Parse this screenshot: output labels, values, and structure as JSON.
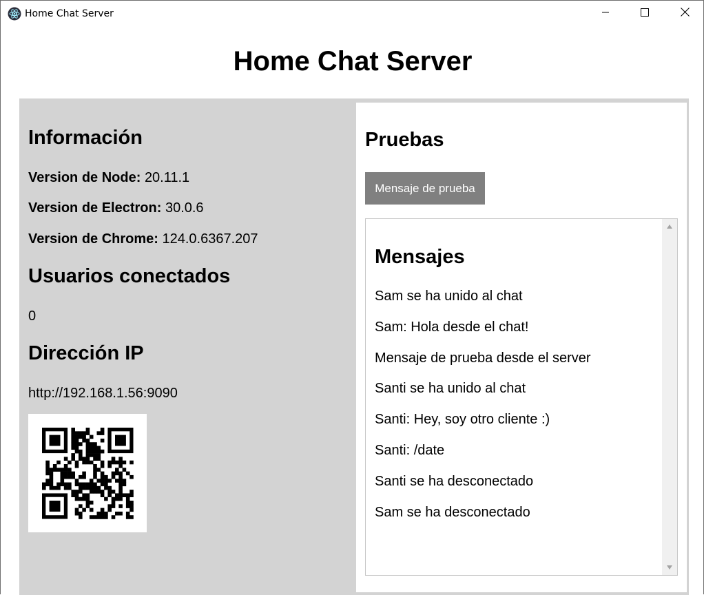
{
  "window": {
    "title": "Home Chat Server"
  },
  "page": {
    "title": "Home Chat Server"
  },
  "info": {
    "heading": "Información",
    "node_label": "Version de Node:",
    "node_value": "20.11.1",
    "electron_label": "Version de Electron:",
    "electron_value": "30.0.6",
    "chrome_label": "Version de Chrome:",
    "chrome_value": "124.0.6367.207"
  },
  "users": {
    "heading": "Usuarios conectados",
    "count": "0"
  },
  "ip": {
    "heading": "Dirección IP",
    "address": "http://192.168.1.56:9090"
  },
  "tests": {
    "heading": "Pruebas",
    "button_label": "Mensaje de prueba"
  },
  "messages": {
    "heading": "Mensajes",
    "items": [
      "Sam se ha unido al chat",
      "Sam: Hola desde el chat!",
      "Mensaje de prueba desde el server",
      "Santi se ha unido al chat",
      "Santi: Hey, soy otro cliente :)",
      "Santi: /date",
      "Santi se ha desconectado",
      "Sam se ha desconectado"
    ]
  },
  "icons": {
    "app": "electron-icon",
    "minimize": "minimize-icon",
    "maximize": "maximize-icon",
    "close": "close-icon",
    "qr": "qr-code-image"
  }
}
